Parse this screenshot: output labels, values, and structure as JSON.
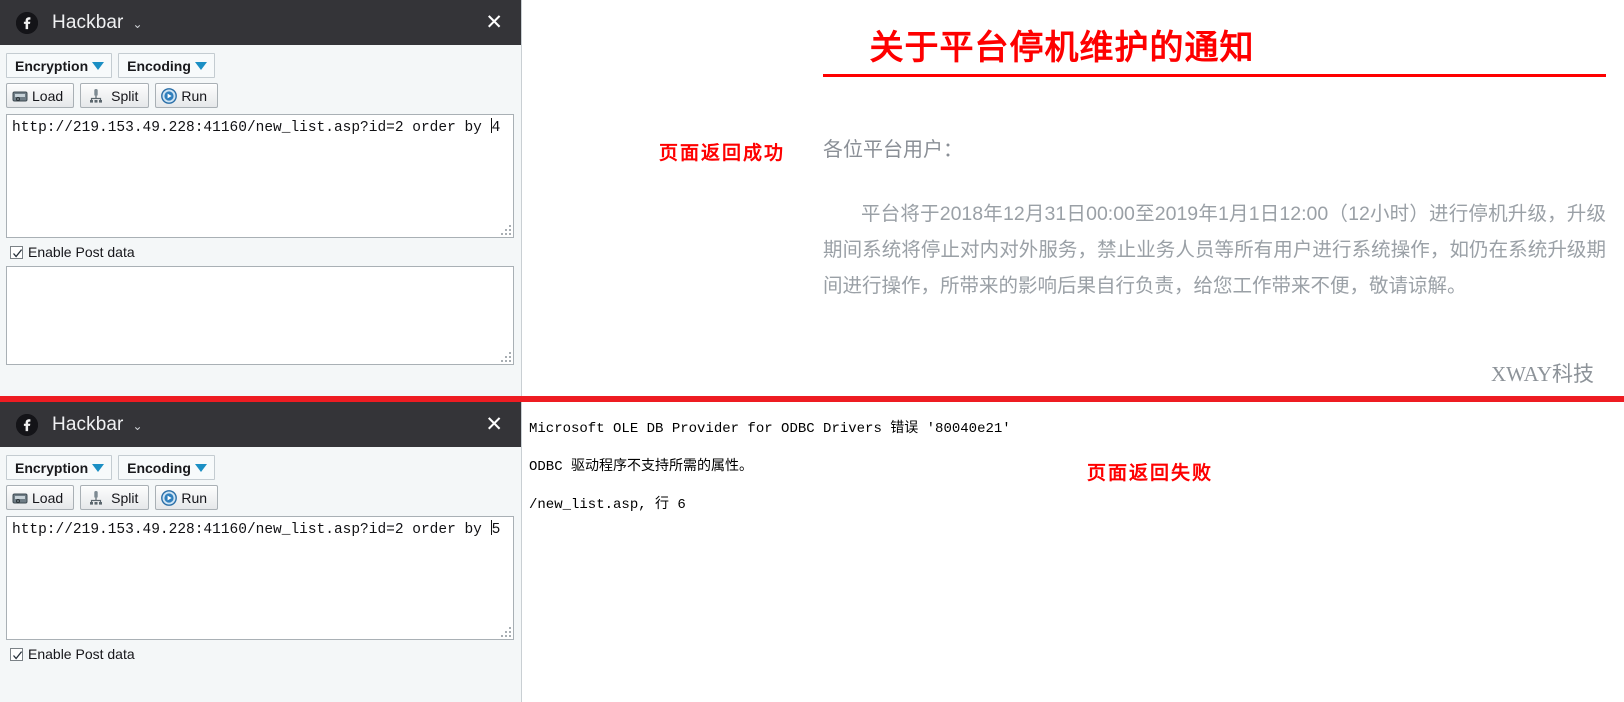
{
  "panels": [
    {
      "title": "Hackbar",
      "caret": "⌄",
      "close": "✕",
      "encryption_label": "Encryption",
      "encoding_label": "Encoding",
      "load_label": "Load",
      "split_label": "Split",
      "run_label": "Run",
      "url_before_caret": "http://219.153.49.228:41160/new_list.asp?id=2 order by ",
      "url_after_caret": "4",
      "post_checkbox_label": "Enable Post data",
      "post_checked": true,
      "post_value": ""
    },
    {
      "title": "Hackbar",
      "caret": "⌄",
      "close": "✕",
      "encryption_label": "Encryption",
      "encoding_label": "Encoding",
      "load_label": "Load",
      "split_label": "Split",
      "run_label": "Run",
      "url_before_caret": "http://219.153.49.228:41160/new_list.asp?id=2 order by ",
      "url_after_caret": "5",
      "post_checkbox_label": "Enable Post data",
      "post_checked": true,
      "post_value": ""
    }
  ],
  "notice": {
    "title": "关于平台停机维护的通知",
    "greeting": "各位平台用户：",
    "paragraph": "平台将于2018年12月31日00:00至2019年1月1日12:00（12小时）进行停机升级，升级期间系统将停止对内对外服务，禁止业务人员等所有用户进行系统操作，如仍在系统升级期间进行操作，所带来的影响后果自行负责，给您工作带来不便，敬请谅解。",
    "signature": "XWAY科技"
  },
  "annotations": {
    "success": "页面返回成功",
    "failure": "页面返回失败"
  },
  "error_page": {
    "lines": [
      "Microsoft OLE DB Provider for ODBC Drivers 错误 '80040e21'",
      "ODBC 驱动程序不支持所需的属性。",
      "/new_list.asp, 行 6"
    ]
  },
  "colors": {
    "titlebar": "#343438",
    "panel_bg": "#f4f7f8",
    "accent_red": "#fe0000",
    "divider_red": "#ee1c22",
    "dropdown_arrow": "#1b8fc4"
  }
}
